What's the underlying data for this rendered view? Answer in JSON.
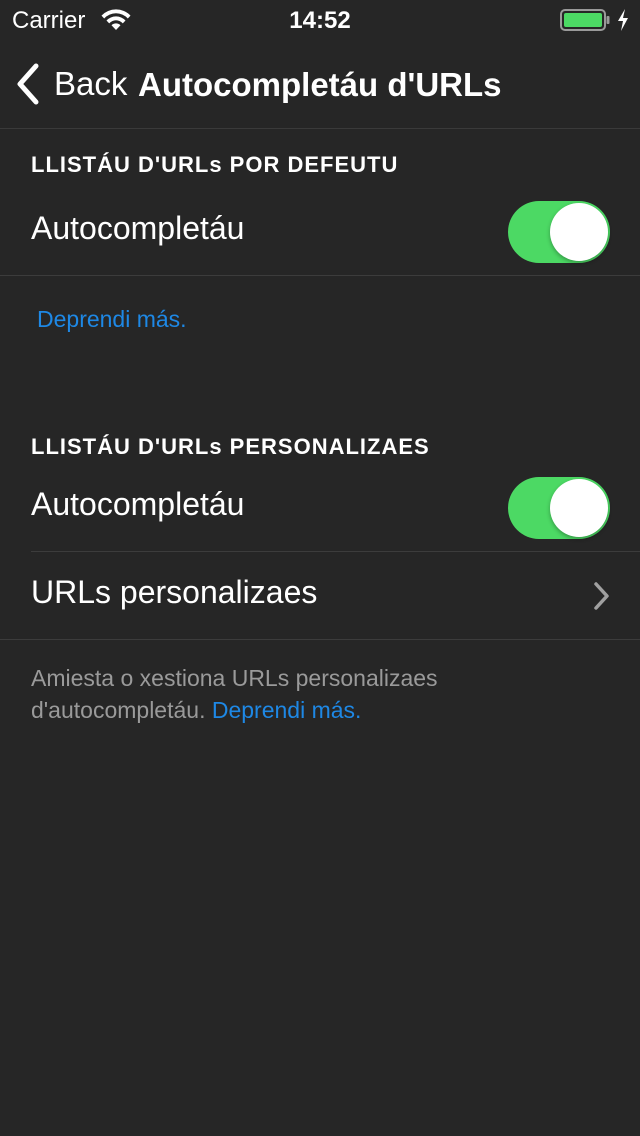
{
  "status_bar": {
    "carrier": "Carrier",
    "time": "14:52"
  },
  "nav": {
    "back_label": "Back",
    "title": "Autocompletáu d'URLs"
  },
  "sections": [
    {
      "header": "LLISTÁU D'URLs POR DEFEUTU",
      "autocomplete_label": "Autocompletáu",
      "autocomplete_on": true,
      "learn_more": "Deprendi más."
    },
    {
      "header": "LLISTÁU D'URLs PERSONALIZAES",
      "autocomplete_label": "Autocompletáu",
      "autocomplete_on": true,
      "custom_urls_label": "URLs personalizaes",
      "footer_text": "Amiesta o xestiona URLs personalizaes d'autocompletáu.",
      "footer_link": "Deprendi más."
    }
  ],
  "colors": {
    "background": "#262626",
    "accent_link": "#1e88e5",
    "toggle_on": "#4cd964",
    "battery": "#4cd964"
  },
  "icons": {
    "wifi": "wifi-icon",
    "battery": "battery-icon",
    "charging": "charging-bolt-icon",
    "back": "chevron-left-icon",
    "disclosure": "chevron-right-icon"
  }
}
